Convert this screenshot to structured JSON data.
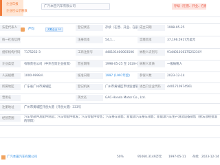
{
  "header": {
    "badge_line1": "企业年报",
    "badge_line2": "企业已公示税数",
    "company_name": "广汽本田汽车有限公司",
    "status_label": "存续（在营、开业、在册）"
  },
  "rows": [
    {
      "label": "法定代表人",
      "value": "严钧",
      "extra": "",
      "label2": "",
      "value2": ""
    },
    {
      "label": "",
      "value": "",
      "extra": "",
      "label2": "",
      "value2": ""
    }
  ],
  "fields": {
    "legal_rep_label": "法定代表人",
    "legal_rep_value": "严钧",
    "legal_rep_tag": "关联企业 52",
    "reg_status_label": "登记状态",
    "reg_status_value": "存续（在营、开业、在册）",
    "founded_label": "成立日期",
    "founded_value": "1998-05-25",
    "credit_code_label": "统一社会信用代码",
    "credit_code_value": "9144010161752523XY",
    "reg_capital_label": "注册资本",
    "reg_capital_value": "54,1…",
    "paid_capital_label": "实缴资本",
    "paid_capital_value": "37,196.5917万美元",
    "org_code_label": "组织机构代码",
    "org_code_value": "7175252-3",
    "reg_no_label": "工商注册号",
    "reg_no_value": "440101400003506",
    "taxpayer_label": "纳税人识别号",
    "taxpayer_value": "9144010161752523XY",
    "company_type_label": "企业类型",
    "company_type_value": "有限责任公司（中外合资企业投资）",
    "term_label": "营业期限",
    "term_value": "1998-05-25 至 2028-05-13",
    "taxpayer_qual_label": "纳税人资质",
    "taxpayer_qual_value": "一般纳税人",
    "industry_label": "所属行业",
    "industry_value": "汽车整车制造",
    "approval_date_label": "核准日期",
    "approval_date_value": "1997 (1997年度)",
    "approval_date_value2": "2023-12-14",
    "staff_label": "人员规模",
    "staff_value": "1000-9999人",
    "insured_label": "参保人数",
    "insured_value": "",
    "region_label": "所属地区",
    "region_value": "广东省广州市黄埔区",
    "authority_label": "登记机关",
    "authority_value": "广州市黄埔区市场监督管理局",
    "import_label": "进出口企业代码",
    "import_value": "4401710974561",
    "former_label": "曾用名",
    "former_value": "GAC-Honda Motor Co., Ltd.",
    "english_label": "英文名",
    "english_value": "GAC-Honda Motor Co., Ltd.",
    "address_label": "注册地址",
    "address_value": "广州市黄埔区开创大道（开创大道）333号",
    "scope_label": "经营范围",
    "scope_value": "汽车零部件及配件制造；汽车零配件批发；汽车零配件零售；汽车整车销售；新能源汽车整车销售；新能源汽车生产测试设备销售（依法须经批准的项目）"
  },
  "bottom_row": {
    "name": "广汽本田汽车有限公司",
    "ratio": "50%",
    "amount": "95060.3149万元",
    "date": "1997-05-11",
    "status": "存续",
    "date2": "2023-12-14"
  }
}
